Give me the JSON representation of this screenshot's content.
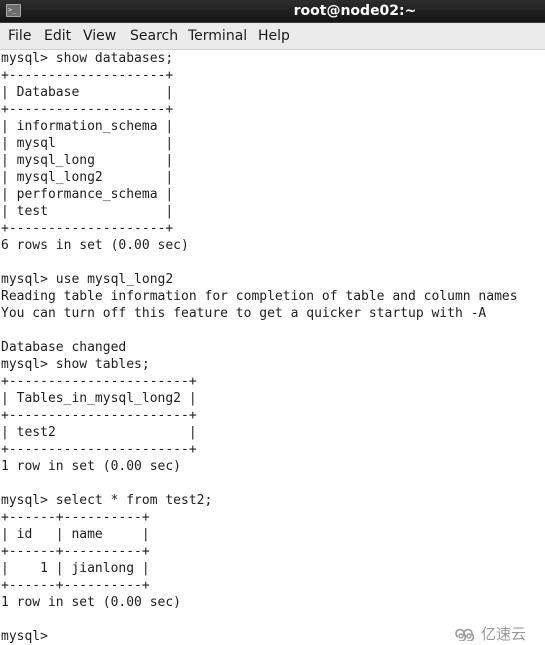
{
  "window": {
    "title": "root@node02:~",
    "icon": "terminal-icon"
  },
  "menubar": {
    "items": [
      {
        "label": "File"
      },
      {
        "label": "Edit"
      },
      {
        "label": "View"
      },
      {
        "label": "Search"
      },
      {
        "label": "Terminal"
      },
      {
        "label": "Help"
      }
    ]
  },
  "terminal": {
    "lines": [
      "mysql> show databases;",
      "+--------------------+",
      "| Database           |",
      "+--------------------+",
      "| information_schema |",
      "| mysql              |",
      "| mysql_long         |",
      "| mysql_long2        |",
      "| performance_schema |",
      "| test               |",
      "+--------------------+",
      "6 rows in set (0.00 sec)",
      "",
      "mysql> use mysql_long2",
      "Reading table information for completion of table and column names",
      "You can turn off this feature to get a quicker startup with -A",
      "",
      "Database changed",
      "mysql> show tables;",
      "+-----------------------+",
      "| Tables_in_mysql_long2 |",
      "+-----------------------+",
      "| test2                 |",
      "+-----------------------+",
      "1 row in set (0.00 sec)",
      "",
      "mysql> select * from test2;",
      "+------+----------+",
      "| id   | name     |",
      "+------+----------+",
      "|    1 | jianlong |",
      "+------+----------+",
      "1 row in set (0.00 sec)",
      "",
      "mysql> "
    ]
  },
  "watermark": {
    "text": "亿速云",
    "icon": "cloud-logo-icon"
  }
}
